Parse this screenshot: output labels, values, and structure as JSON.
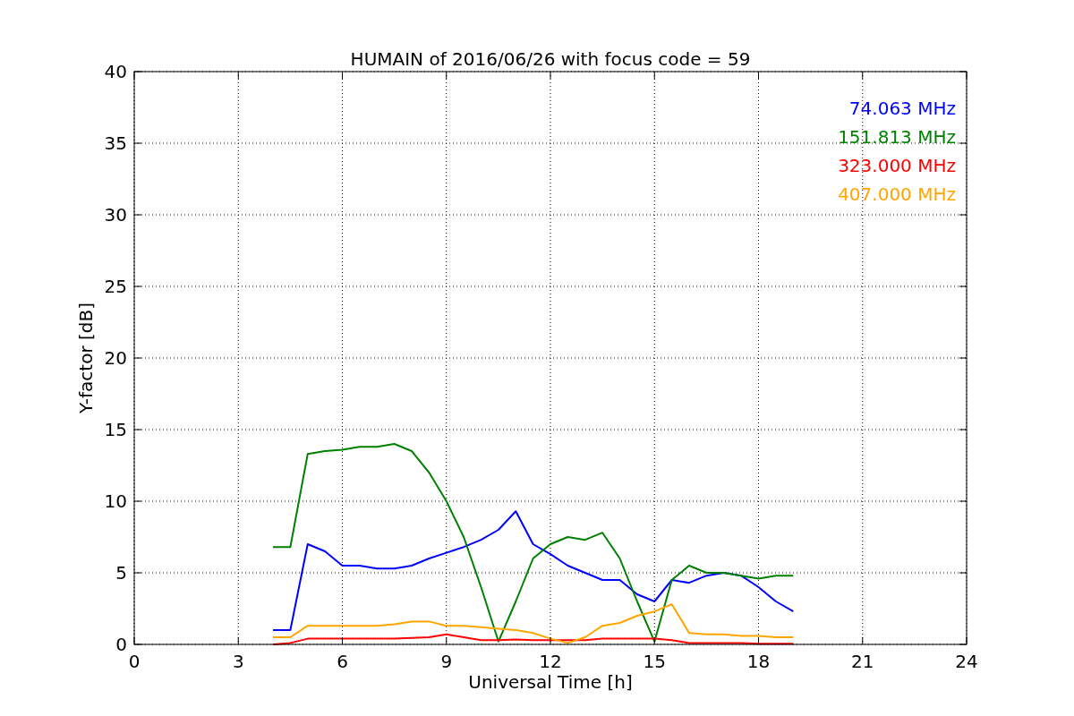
{
  "chart": {
    "chart_data": {
      "type": "line",
      "title": "HUMAIN of 2016/06/26 with focus code = 59",
      "xlabel": "Universal Time [h]",
      "ylabel": "Y-factor [dB]",
      "x": [
        4,
        4.5,
        5,
        5.5,
        6,
        6.5,
        7,
        7.5,
        8,
        8.5,
        9,
        9.5,
        10,
        10.5,
        11,
        11.5,
        12,
        12.5,
        13,
        13.5,
        14,
        14.5,
        15,
        15.5,
        16,
        16.5,
        17,
        17.5,
        18,
        18.5,
        19
      ],
      "series": [
        {
          "name": "74.063 MHz",
          "color": "#0000ff",
          "values": [
            1.0,
            1.0,
            7.0,
            6.5,
            5.5,
            5.5,
            5.3,
            5.3,
            5.5,
            6.0,
            6.4,
            6.8,
            7.3,
            8.0,
            9.3,
            7.0,
            6.3,
            5.5,
            5.0,
            4.5,
            4.5,
            3.5,
            3.0,
            4.5,
            4.3,
            4.8,
            5.0,
            4.8,
            4.0,
            3.0,
            2.3
          ]
        },
        {
          "name": "151.813 MHz",
          "color": "#008000",
          "values": [
            6.8,
            6.8,
            13.3,
            13.5,
            13.6,
            13.8,
            13.8,
            14.0,
            13.5,
            12.0,
            10.0,
            7.5,
            4.0,
            0.2,
            3.0,
            6.0,
            7.0,
            7.5,
            7.3,
            7.8,
            6.0,
            3.0,
            0.2,
            4.5,
            5.5,
            5.0,
            5.0,
            4.8,
            4.6,
            4.8,
            4.8
          ]
        },
        {
          "name": "323.000 MHz",
          "color": "#ff0000",
          "values": [
            0.0,
            0.1,
            0.4,
            0.4,
            0.4,
            0.4,
            0.4,
            0.4,
            0.45,
            0.5,
            0.7,
            0.5,
            0.3,
            0.3,
            0.35,
            0.3,
            0.3,
            0.3,
            0.3,
            0.4,
            0.4,
            0.4,
            0.4,
            0.3,
            0.1,
            0.1,
            0.1,
            0.1,
            0.05,
            0.05,
            0.05
          ]
        },
        {
          "name": "407.000 MHz",
          "color": "#ffa500",
          "values": [
            0.5,
            0.5,
            1.3,
            1.3,
            1.3,
            1.3,
            1.3,
            1.4,
            1.6,
            1.6,
            1.3,
            1.3,
            1.2,
            1.1,
            1.0,
            0.8,
            0.4,
            0.1,
            0.5,
            1.3,
            1.5,
            2.0,
            2.3,
            2.8,
            0.8,
            0.7,
            0.7,
            0.6,
            0.6,
            0.5,
            0.5
          ]
        }
      ],
      "xlim": [
        0,
        24
      ],
      "ylim": [
        0,
        40
      ],
      "xticks": [
        0,
        3,
        6,
        9,
        12,
        15,
        18,
        21,
        24
      ],
      "yticks": [
        0,
        5,
        10,
        15,
        20,
        25,
        30,
        35,
        40
      ],
      "grid": true
    }
  }
}
